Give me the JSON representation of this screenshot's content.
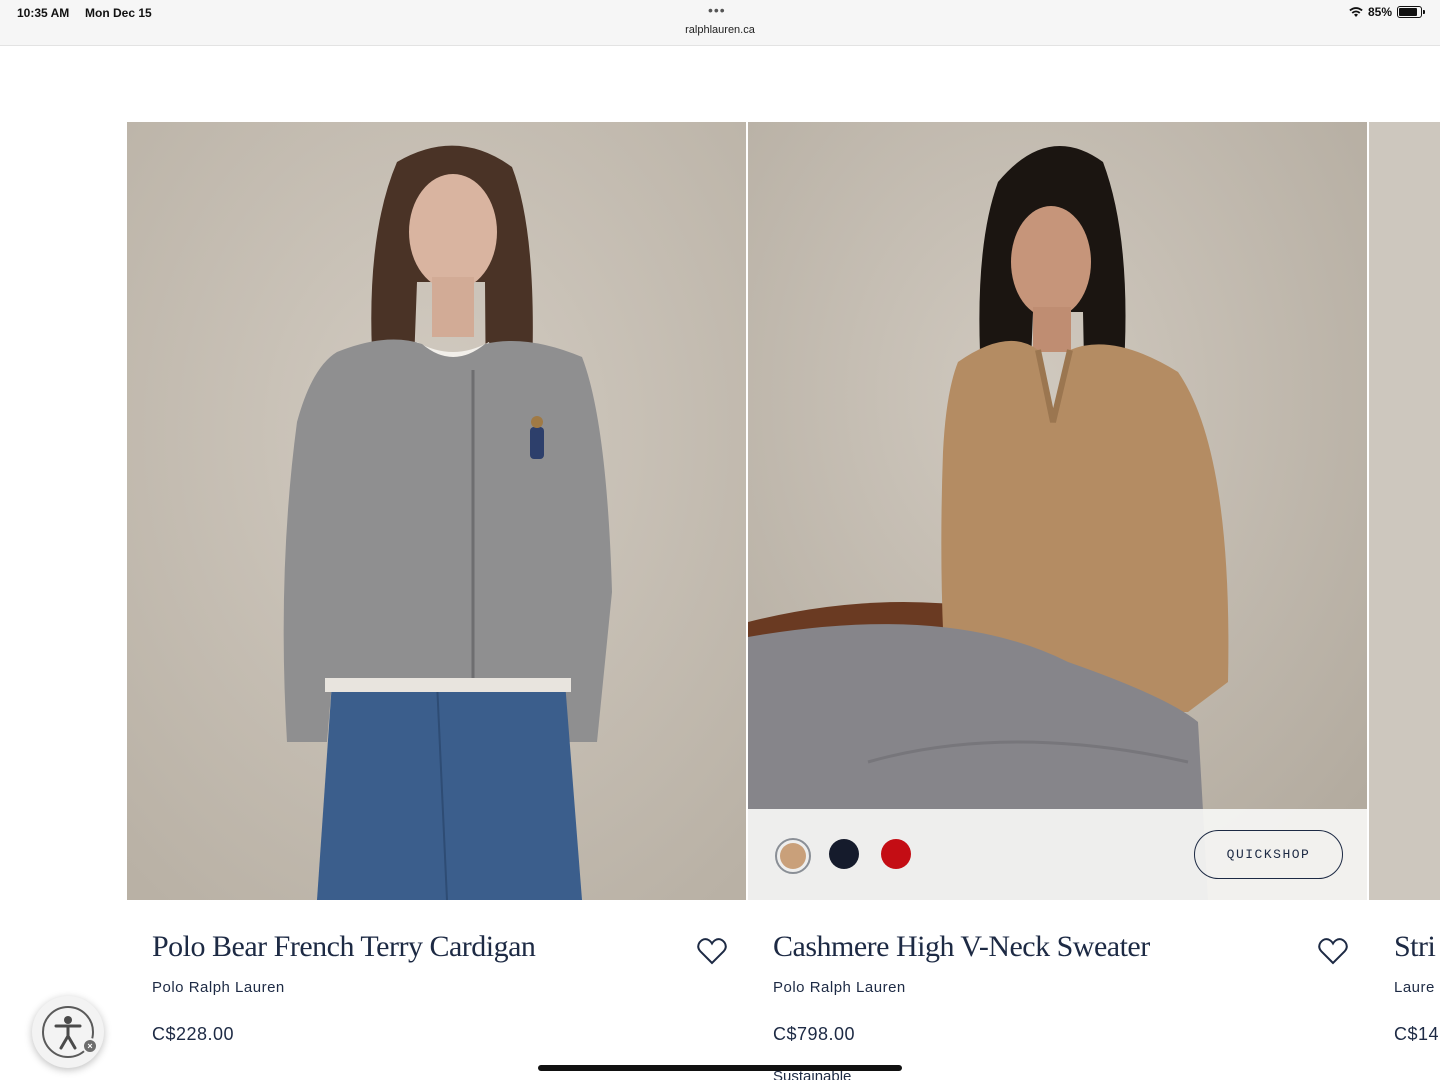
{
  "status_bar": {
    "time": "10:35 AM",
    "date": "Mon Dec 15",
    "url": "ralphlauren.ca",
    "battery": "85%",
    "battery_level": 0.85,
    "menu_dots": "•••"
  },
  "products": [
    {
      "title": "Polo Bear French Terry Cardigan",
      "brand": "Polo Ralph Lauren",
      "price": "C$228.00"
    },
    {
      "title": "Cashmere High V-Neck Sweater",
      "brand": "Polo Ralph Lauren",
      "price": "C$798.00",
      "note": "Sustainable",
      "quickshop_label": "QUICKSHOP",
      "swatches": [
        {
          "color": "#c9a07a",
          "selected": true
        },
        {
          "color": "#151b2c",
          "selected": false
        },
        {
          "color": "#c40d14",
          "selected": false
        }
      ]
    },
    {
      "title": "Stri",
      "brand": "Laure",
      "price": "C$14"
    }
  ],
  "colors": {
    "navy": "#1d2a44",
    "backdrop": "#cbc4b9"
  },
  "icons": {
    "favorite": "heart-outline-icon",
    "accessibility": "accessibility-person-icon"
  }
}
